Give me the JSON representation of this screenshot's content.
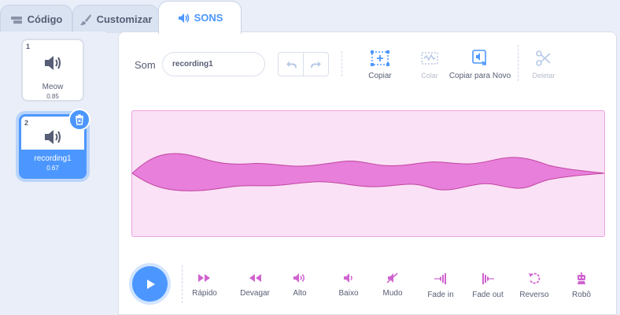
{
  "tabs": {
    "code": "Código",
    "costumes": "Customizar",
    "sounds": "SONS"
  },
  "sounds": [
    {
      "number": "1",
      "name": "Meow",
      "duration": "0.85"
    },
    {
      "number": "2",
      "name": "recording1",
      "duration": "0.67"
    }
  ],
  "editor": {
    "sound_label": "Som",
    "sound_name_value": "recording1",
    "tools": {
      "copy": "Copiar",
      "paste": "Colar",
      "copy_to_new": "Copiar para Novo",
      "delete": "Deletar"
    }
  },
  "effects": {
    "faster": "Rápido",
    "slower": "Devagar",
    "louder": "Alto",
    "softer": "Baixo",
    "mute": "Mudo",
    "fade_in": "Fade in",
    "fade_out": "Fade out",
    "reverse": "Reverso",
    "robot": "Robô"
  },
  "colors": {
    "accent": "#4c97ff",
    "effect_icon": "#cf63cf",
    "wave_fill": "#e77fdb",
    "wave_bg": "#fae1f6"
  }
}
